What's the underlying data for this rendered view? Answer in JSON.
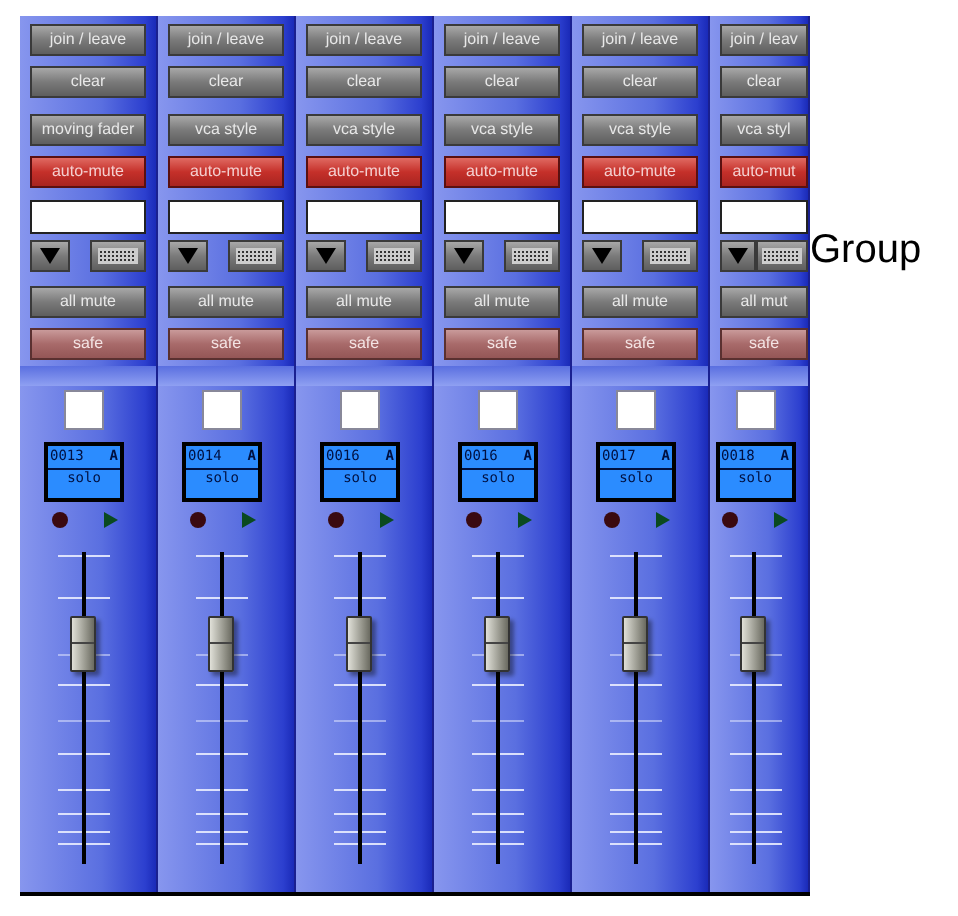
{
  "strips": [
    {
      "join": "join / leave",
      "clear": "clear",
      "mode": "moving fader",
      "select_checked": false,
      "auto_mute": {
        "label": "auto-mute",
        "on": true
      },
      "all_mute": "all mute",
      "safe": "safe",
      "display": {
        "id": "0013",
        "bank": "A",
        "mode": "solo"
      }
    },
    {
      "join": "join / leave",
      "clear": "clear",
      "mode": "vca style",
      "select_checked": false,
      "auto_mute": {
        "label": "auto-mute",
        "on": true
      },
      "all_mute": "all mute",
      "safe": "safe",
      "display": {
        "id": "0014",
        "bank": "A",
        "mode": "solo"
      }
    },
    {
      "join": "join / leave",
      "clear": "clear",
      "mode": "vca style",
      "select_checked": false,
      "auto_mute": {
        "label": "auto-mute",
        "on": true
      },
      "all_mute": "all mute",
      "safe": "safe",
      "display": {
        "id": "0016",
        "bank": "A",
        "mode": "solo"
      }
    },
    {
      "join": "join / leave",
      "clear": "clear",
      "mode": "vca style",
      "select_checked": false,
      "auto_mute": {
        "label": "auto-mute",
        "on": true
      },
      "all_mute": "all mute",
      "safe": "safe",
      "display": {
        "id": "0016",
        "bank": "A",
        "mode": "solo"
      }
    },
    {
      "join": "join / leave",
      "clear": "clear",
      "mode": "vca style",
      "select_checked": false,
      "auto_mute": {
        "label": "auto-mute",
        "on": true
      },
      "all_mute": "all mute",
      "safe": "safe",
      "display": {
        "id": "0017",
        "bank": "A",
        "mode": "solo"
      }
    },
    {
      "join": "join / leav",
      "clear": "clear",
      "mode": "vca styl",
      "select_checked": false,
      "auto_mute": {
        "label": "auto-mut",
        "on": true
      },
      "all_mute": "all mut",
      "safe": "safe",
      "display": {
        "id": "0018",
        "bank": "A",
        "mode": "solo"
      }
    }
  ],
  "label": "Group"
}
